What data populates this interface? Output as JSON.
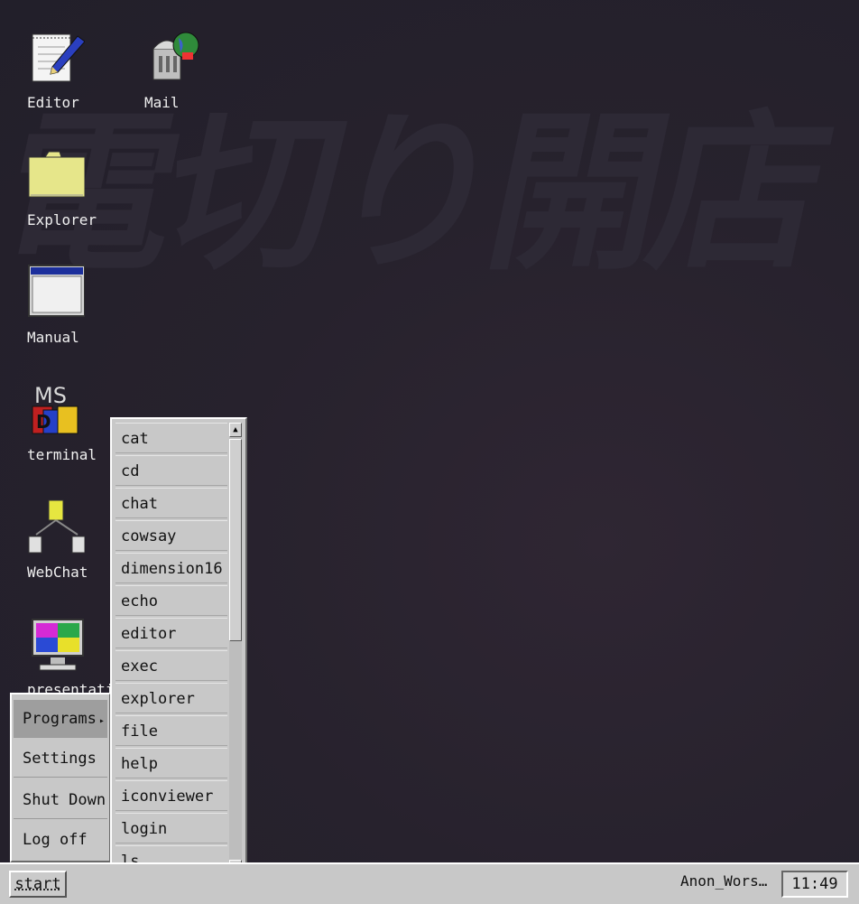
{
  "desktop": {
    "watermark": "電切り開店",
    "icons": [
      {
        "label": "Editor",
        "icon": "notepad-pen-icon"
      },
      {
        "label": "Mail",
        "icon": "mailbox-icon"
      },
      {
        "label": "Explorer",
        "icon": "folder-icon"
      },
      {
        "label": "Manual",
        "icon": "window-icon"
      },
      {
        "label": "terminal",
        "icon": "msdos-icon"
      },
      {
        "label": "WebChat",
        "icon": "network-icon"
      },
      {
        "label": "presentation",
        "icon": "monitor-icon"
      }
    ],
    "msdos_text": "MS"
  },
  "start_menu": {
    "items": [
      {
        "label": "Programs",
        "submenu_arrow": "▸"
      },
      {
        "label": "Settings"
      },
      {
        "label": "Shut Down"
      },
      {
        "label": "Log off"
      }
    ]
  },
  "programs_menu": {
    "items": [
      "cat",
      "cd",
      "chat",
      "cowsay",
      "dimension16",
      "echo",
      "editor",
      "exec",
      "explorer",
      "file",
      "help",
      "iconviewer",
      "login",
      "ls"
    ],
    "scroll_up": "▲",
    "scroll_down": "▼"
  },
  "taskbar": {
    "start_label": "start",
    "user": "Anon_Wors…",
    "clock": "11:49"
  },
  "colors": {
    "desktop_bg": "#27222d",
    "menu_bg": "#c8c8c8",
    "menu_active": "#9e9e9e"
  }
}
